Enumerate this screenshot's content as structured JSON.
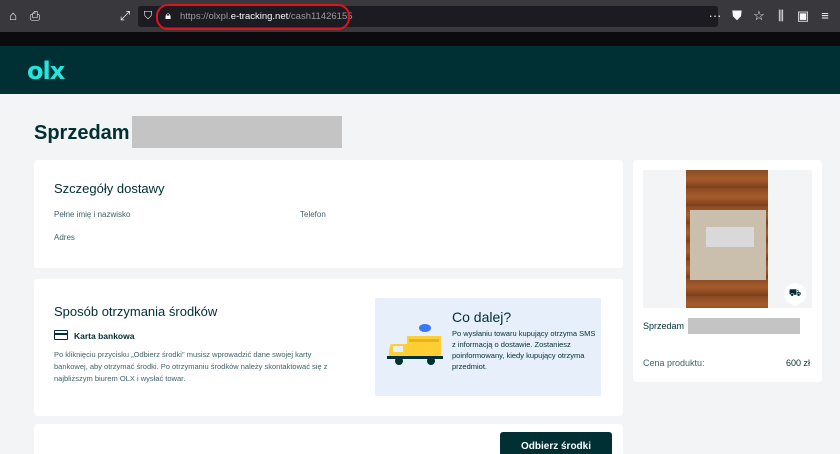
{
  "browser": {
    "url_prefix": "https://olxpl.",
    "url_domain": "e-tracking.net",
    "url_path": "/cash11426155",
    "icons": {
      "home": "home-icon",
      "print": "print-icon",
      "fullscreen": "expand-icon",
      "shield": "shield-icon",
      "lock": "lock-icon",
      "more": "more-icon",
      "pocket": "pocket-icon",
      "star": "star-icon",
      "library": "library-icon",
      "menu": "hamburger-icon"
    },
    "highlight_color": "#e0141e"
  },
  "header": {
    "logo": "olx"
  },
  "page": {
    "title": "Sprzedam"
  },
  "delivery": {
    "title": "Szczegóły dostawy",
    "name_label": "Pełne imię i nazwisko",
    "phone_label": "Telefon",
    "address_label": "Adres"
  },
  "payout": {
    "title": "Sposób otrzymania środków",
    "method": "Karta bankowa",
    "description": "Po kliknięciu przycisku „Odbierz środki\" musisz wprowadzić dane swojej karty bankowej, aby otrzymać środki. Po otrzymaniu środków należy skontaktować się z najbliższym biurem OLX i wysłać towar.",
    "next_title": "Co dalej?",
    "next_text": "Po wysłaniu towaru kupujący otrzyma SMS z informacją o dostawie. Zostaniesz poinformowany, kiedy kupujący otrzyma przedmiot."
  },
  "action": {
    "button_label": "Odbierz środki"
  },
  "product": {
    "title": "Sprzedam",
    "price_label": "Cena produktu:",
    "price_value": "600 zł"
  },
  "colors": {
    "brand_dark": "#002f34",
    "brand_accent": "#23e5db",
    "info_box": "#e6effa"
  }
}
